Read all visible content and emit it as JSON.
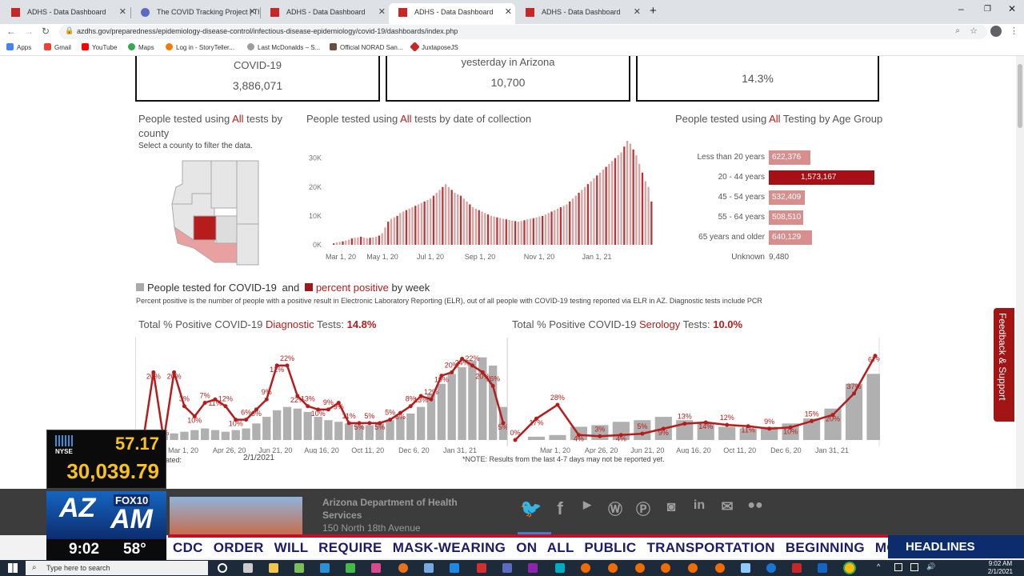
{
  "browser": {
    "tabs": [
      {
        "title": "ADHS - Data Dashboard",
        "active": false
      },
      {
        "title": "The COVID Tracking Project | The",
        "active": false
      },
      {
        "title": "ADHS - Data Dashboard",
        "active": false
      },
      {
        "title": "ADHS - Data Dashboard",
        "active": true
      },
      {
        "title": "ADHS - Data Dashboard",
        "active": false
      }
    ],
    "url": "azdhs.gov/preparedness/epidemiology-disease-control/infectious-disease-epidemiology/covid-19/dashboards/index.php",
    "bookmarks": [
      "Apps",
      "Gmail",
      "YouTube",
      "Maps",
      "Log in - StoryTeller...",
      "Last McDonalds – S...",
      "Official NORAD San...",
      "JuxtaposeJS"
    ]
  },
  "stats": {
    "box1": {
      "label": "COVID-19",
      "value": "3,886,071"
    },
    "box2": {
      "label": "yesterday in Arizona",
      "value": "10,700"
    },
    "box3": {
      "label": "",
      "value": "14.3%"
    }
  },
  "county": {
    "title_pre": "People tested using ",
    "title_red": "All",
    "title_post": " tests by county",
    "sub": "Select a county to filter the data."
  },
  "datechart": {
    "title_pre": "People tested using ",
    "title_red": "All",
    "title_post": " tests by date of collection"
  },
  "age": {
    "title_pre": "People tested using ",
    "title_red": "All",
    "title_post": " Testing by Age Group"
  },
  "weekly": {
    "legend_a": "People tested for COVID-19",
    "legend_and": "and",
    "legend_b": "percent positive",
    "legend_c": "by week",
    "note": "Percent positive is the number of people with a positive result in Electronic Laboratory Reporting (ELR), out of all people with COVID-19 testing reported via ELR in AZ. Diagnostic tests include PCR",
    "diag_title_pre": "Total % Positive COVID-19 ",
    "diag_title_red": "Diagnostic",
    "diag_title_post": " Tests: ",
    "diag_value": "14.8%",
    "sero_title_pre": "Total % Positive COVID-19 ",
    "sero_title_red": "Serology",
    "sero_title_post": " Tests: ",
    "sero_value": "10.0%",
    "updated_label": "lated:",
    "updated_value": "2/1/2021",
    "footnote": "*NOTE: Results from the last 4-7 days may not be reported yet."
  },
  "feedback": "Feedback & Support",
  "footer": {
    "org": "Arizona Department of Health Services",
    "address": "150 North 18th Avenue"
  },
  "tv": {
    "exchange": "NYSE",
    "stock_change": "57.17",
    "stock_value": "30,039.79",
    "logo_a": "AZ",
    "logo_b": "FOX10",
    "logo_c": "AM",
    "time": "9:02",
    "temp": "58°",
    "ticker": "CDC ORDER WILL REQUIRE MASK-WEARING ON ALL PUBLIC TRANSPORTATION BEGINNING MONDAY",
    "headlines": "HEADLINES"
  },
  "taskbar": {
    "search_placeholder": "Type here to search",
    "time": "9:02 AM",
    "date": "2/1/2021"
  },
  "chart_data": [
    {
      "type": "bar",
      "title": "People tested using All tests by date of collection",
      "x_ticks": [
        "Mar 1, 20",
        "May 1, 20",
        "Jul 1, 20",
        "Sep 1, 20",
        "Nov 1, 20",
        "Jan 1, 21"
      ],
      "y_ticks": [
        "0K",
        "10K",
        "20K",
        "30K"
      ],
      "ylim": [
        0,
        36000
      ],
      "values": [
        500,
        800,
        1000,
        1200,
        1500,
        1800,
        2200,
        2400,
        2600,
        2800,
        2500,
        2300,
        2400,
        2600,
        2800,
        3200,
        4000,
        6000,
        8000,
        9000,
        9500,
        10000,
        11000,
        11500,
        12000,
        12500,
        13000,
        13500,
        14000,
        14500,
        15000,
        15500,
        16000,
        17000,
        18000,
        19000,
        20000,
        21000,
        20000,
        19000,
        18000,
        17500,
        17000,
        16000,
        15000,
        14000,
        13000,
        12500,
        12000,
        11500,
        11000,
        10500,
        10000,
        9800,
        9500,
        9300,
        9000,
        8800,
        8600,
        8400,
        8200,
        8000,
        8200,
        8500,
        8800,
        9000,
        9200,
        9500,
        9800,
        10000,
        10500,
        11000,
        11500,
        12000,
        12500,
        13000,
        13500,
        14000,
        15000,
        16000,
        17000,
        18000,
        19000,
        20000,
        21000,
        22000,
        23000,
        24000,
        25000,
        26000,
        27000,
        28000,
        29000,
        30000,
        31000,
        32000,
        34000,
        36000,
        35000,
        33000,
        31000,
        28000,
        25000,
        22000,
        20000,
        15000
      ]
    },
    {
      "type": "bar",
      "title": "People tested using All Testing by Age Group",
      "categories": [
        "Less than 20 years",
        "20 - 44 years",
        "45 - 54 years",
        "55 - 64 years",
        "65 years and older",
        "Unknown"
      ],
      "values": [
        622376,
        1573167,
        532409,
        508510,
        640129,
        9480
      ],
      "labels": [
        "622,376",
        "1,573,167",
        "532,409",
        "508,510",
        "640,129",
        "9,480"
      ]
    },
    {
      "type": "line",
      "title": "Total % Positive COVID-19 Diagnostic Tests: 14.8%",
      "x_ticks": [
        "Mar 1, 20",
        "Apr 26, 20",
        "Jun 21, 20",
        "Aug 16, 20",
        "Oct 11, 20",
        "Dec 6, 20",
        "Jan 31, 21"
      ],
      "series": [
        {
          "values": [
            0,
            20,
            0,
            20,
            10,
            7,
            11,
            12,
            10,
            6,
            6,
            9,
            12,
            22,
            22,
            13,
            10,
            9,
            9,
            11,
            5,
            5,
            5,
            5,
            6,
            8,
            10,
            13,
            12,
            19,
            20,
            24,
            22,
            20,
            16,
            5
          ]
        },
        {
          "values": [
            2,
            3,
            3,
            4,
            5,
            6,
            7,
            6,
            5,
            6,
            7,
            10,
            14,
            18,
            20,
            19,
            17,
            14,
            12,
            11,
            10,
            9,
            9,
            10,
            12,
            14,
            16,
            20,
            28,
            34,
            40,
            44,
            48,
            50,
            45,
            20
          ]
        }
      ],
      "labels": [
        "0%",
        "20%",
        "0%",
        "20%",
        "3%",
        "10%",
        "7%",
        "11%",
        "12%",
        "10%",
        "6%",
        "6%",
        "9%",
        "12%",
        "22%",
        "22%",
        "13%",
        "10%",
        "9%",
        "9%",
        "11%",
        "5%",
        "5%",
        "5%",
        "5%",
        "6%",
        "8%",
        "13%",
        "12%",
        "19%",
        "20%",
        "24%",
        "22%",
        "20%",
        "16%",
        "5%"
      ]
    },
    {
      "type": "line",
      "title": "Total % Positive COVID-19 Serology Tests: 10.0%",
      "x_ticks": [
        "Mar 1, 20",
        "Apr 26, 20",
        "Jun 21, 20",
        "Aug 16, 20",
        "Oct 11, 20",
        "Dec 6, 20",
        "Jan 31, 21"
      ],
      "series": [
        {
          "values": [
            0,
            17,
            28,
            4,
            3,
            4,
            5,
            9,
            13,
            14,
            12,
            11,
            9,
            10,
            15,
            20,
            37,
            67
          ]
        },
        {
          "values": [
            0,
            2,
            3,
            8,
            9,
            11,
            12,
            14,
            12,
            10,
            8,
            7,
            8,
            10,
            13,
            19,
            34,
            40
          ]
        }
      ],
      "labels": [
        "0%",
        "17%",
        "28%",
        "4%",
        "3%",
        "4%",
        "5%",
        "9%",
        "13%",
        "14%",
        "12%",
        "11%",
        "9%",
        "10%",
        "15%",
        "20%",
        "37%",
        "67%"
      ]
    }
  ]
}
